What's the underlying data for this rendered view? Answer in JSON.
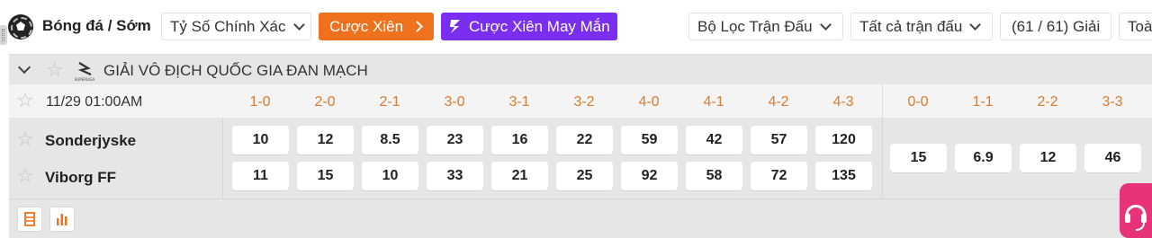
{
  "topbar": {
    "title": "Bóng đá / Sớm",
    "bet_type_select": "Tỷ Số Chính Xác",
    "parlay_button": "Cược Xiên",
    "lucky_parlay_button": "Cược Xiên May Mắn",
    "match_filter_select": "Bộ Lọc Trận Đấu",
    "all_matches_select": "Tất cả trận đấu",
    "leagues_count": "(61 / 61) Giải",
    "overflow_text": "Toà"
  },
  "league": {
    "name": "GIẢI VÔ ĐỊCH QUỐC GIA ĐAN MẠCH",
    "logo_text": "SUPERLIGA"
  },
  "match": {
    "time": "11/29 01:00AM",
    "home_team": "Sonderjyske",
    "away_team": "Viborg FF"
  },
  "score_headers": [
    "1-0",
    "2-0",
    "2-1",
    "3-0",
    "3-1",
    "3-2",
    "4-0",
    "4-1",
    "4-2",
    "4-3",
    "0-0",
    "1-1",
    "2-2",
    "3-3"
  ],
  "home_odds": [
    "10",
    "12",
    "8.5",
    "23",
    "16",
    "22",
    "59",
    "42",
    "57",
    "120"
  ],
  "away_odds": [
    "11",
    "15",
    "10",
    "33",
    "21",
    "25",
    "92",
    "58",
    "72",
    "135"
  ],
  "draw_odds": [
    "15",
    "6.9",
    "12",
    "46"
  ],
  "colors": {
    "accent_orange": "#f0711d",
    "accent_purple": "#7a2ff0",
    "score_header": "#e07b2c",
    "support_pink": "#e8327a"
  }
}
